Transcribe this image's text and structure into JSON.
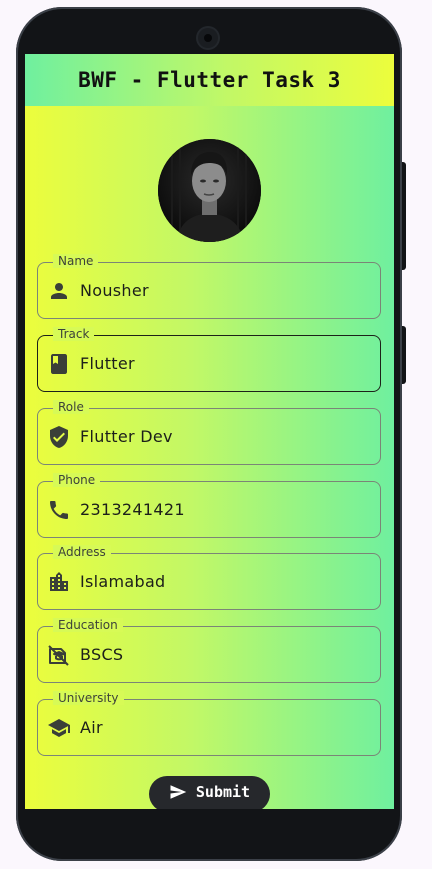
{
  "app": {
    "title": "BWF - Flutter Task 3"
  },
  "profile": {
    "avatar_alt": ""
  },
  "fields": [
    {
      "label": "Name",
      "value": "Nousher",
      "icon": "person-icon"
    },
    {
      "label": "Track",
      "value": "Flutter",
      "icon": "book-icon"
    },
    {
      "label": "Role",
      "value": "Flutter Dev",
      "icon": "verified-shield-icon"
    },
    {
      "label": "Phone",
      "value": "2313241421",
      "icon": "phone-icon"
    },
    {
      "label": "Address",
      "value": "Islamabad",
      "icon": "city-icon"
    },
    {
      "label": "Education",
      "value": "BSCS",
      "icon": "education-icon"
    },
    {
      "label": "University",
      "value": "Air",
      "icon": "school-cap-icon"
    }
  ],
  "submit": {
    "label": "Submit",
    "icon": "send-icon"
  },
  "colors": {
    "gradient_yellow": "#ecfd3c",
    "gradient_green": "#6ff09f",
    "button_bg": "#26282c",
    "border": "#7b8577"
  }
}
